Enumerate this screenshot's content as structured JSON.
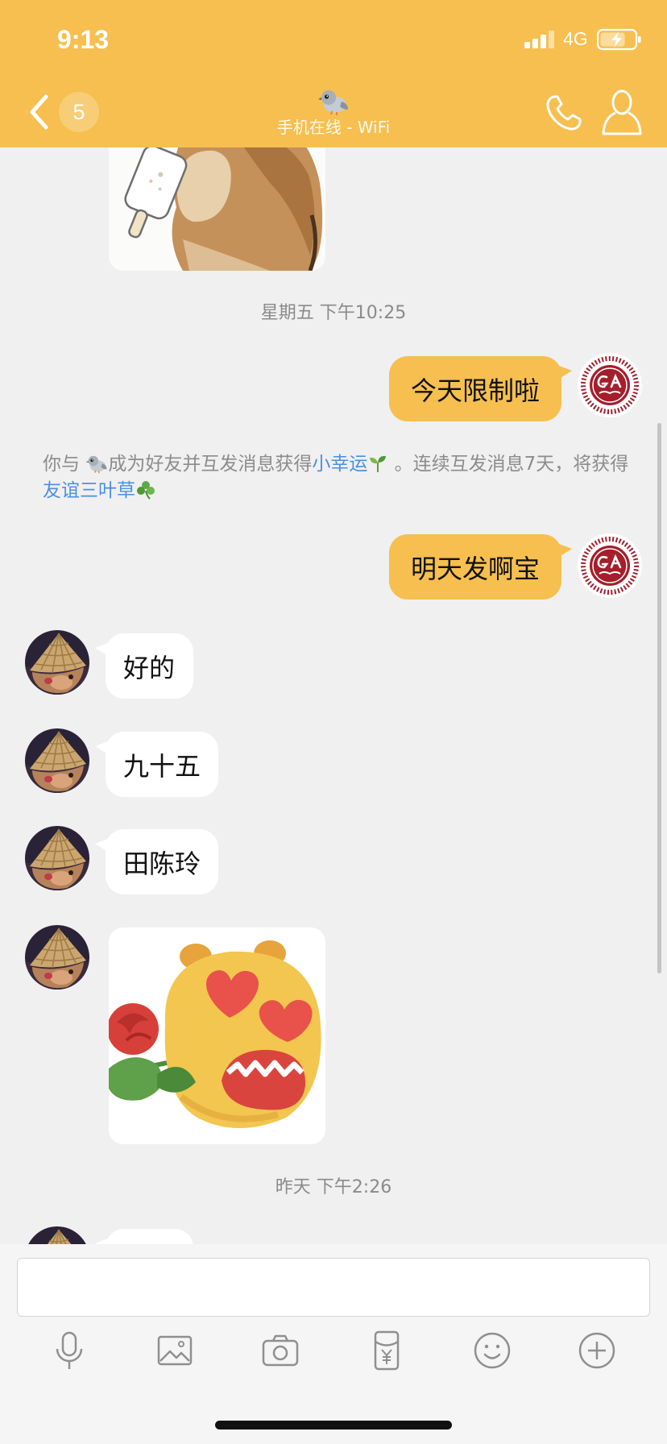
{
  "status_bar": {
    "time": "9:13",
    "network": "4G",
    "signal_icon": "cellular-signal-icon",
    "battery_icon": "battery-charging-icon"
  },
  "header": {
    "back_icon": "chevron-left-icon",
    "unread_count": "5",
    "contact_icon": "pigeon-emoji-icon",
    "subtitle": "手机在线 - WiFi",
    "call_icon": "phone-icon",
    "profile_icon": "person-icon"
  },
  "theme": {
    "accent": "#F6BF4F",
    "chat_background": "#F0F0F0",
    "sent_bubble": "#F6BF4F",
    "received_bubble": "#FFFFFF",
    "secondary_text": "#8C8C8C",
    "link": "#4A90E2"
  },
  "messages": [
    {
      "kind": "image",
      "direction": "received",
      "icon": "dog-with-popsicle-sticker"
    },
    {
      "kind": "timestamp",
      "text": "星期五 下午10:25"
    },
    {
      "kind": "text",
      "direction": "sent",
      "text": "今天限制啦",
      "avatar": "school-logo-avatar"
    },
    {
      "kind": "system",
      "text_1": "你与",
      "icon_1": "pigeon-emoji-icon",
      "text_2": "成为好友并互发消息获得",
      "link_1": "小幸运",
      "icon_2": "sprout-icon",
      "text_3": "。连续互发消息7天，将获得",
      "link_2": "友谊三叶草",
      "icon_3": "clover-icon"
    },
    {
      "kind": "text",
      "direction": "sent",
      "text": "明天发啊宝",
      "avatar": "school-logo-avatar"
    },
    {
      "kind": "text",
      "direction": "received",
      "text": "好的",
      "avatar": "contact-avatar"
    },
    {
      "kind": "text",
      "direction": "received",
      "text": "九十五",
      "avatar": "contact-avatar"
    },
    {
      "kind": "text",
      "direction": "received",
      "text": "田陈玲",
      "avatar": "contact-avatar"
    },
    {
      "kind": "image",
      "direction": "received",
      "icon": "heart-eyes-rose-sticker",
      "avatar": "contact-avatar"
    },
    {
      "kind": "timestamp",
      "text": "昨天 下午2:26"
    },
    {
      "kind": "text",
      "direction": "received",
      "avatar": "contact-avatar"
    }
  ],
  "composer": {
    "input_value": "",
    "toolbar_icons": [
      "microphone-icon",
      "photo-icon",
      "camera-icon",
      "red-packet-icon",
      "emoji-icon",
      "plus-icon"
    ]
  }
}
